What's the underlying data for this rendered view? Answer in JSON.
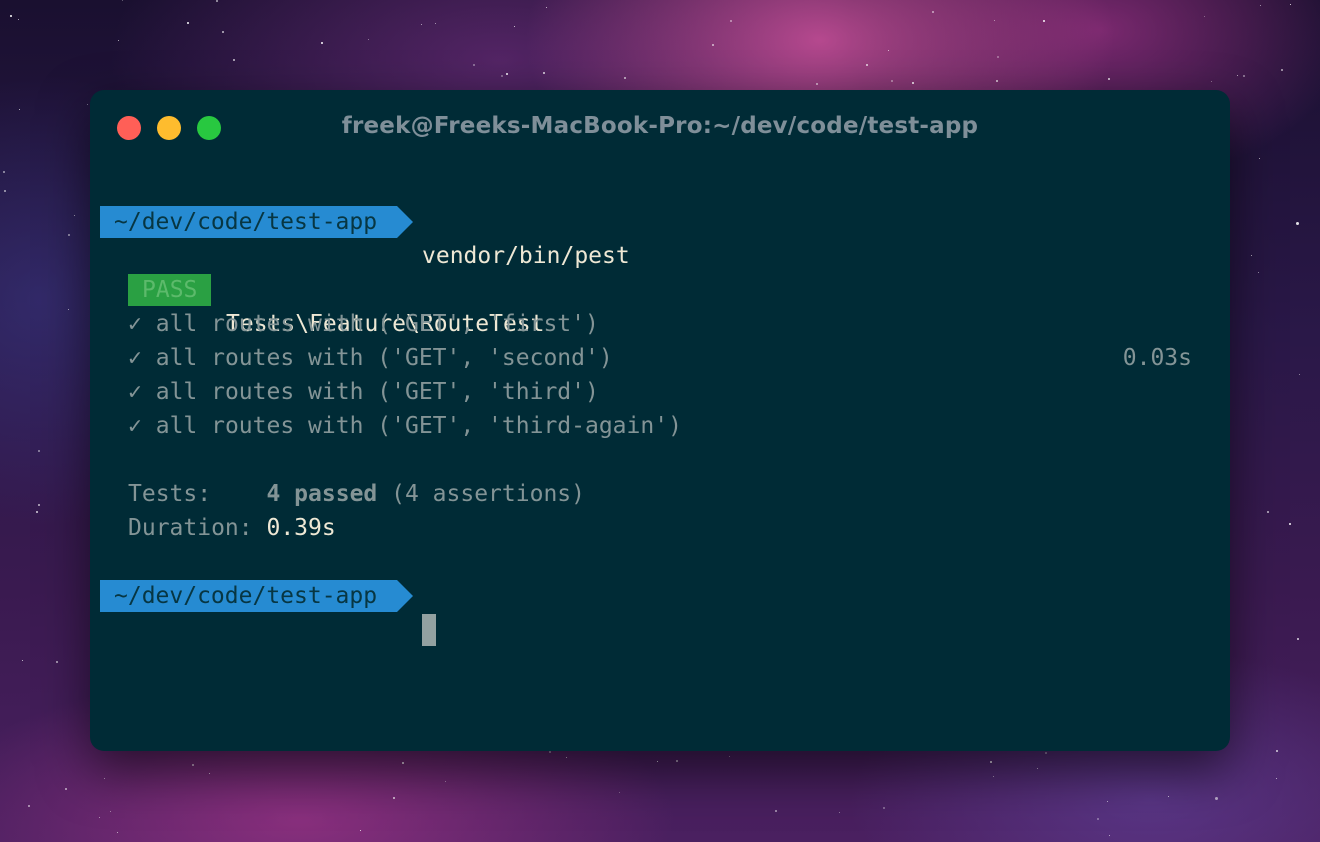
{
  "window": {
    "title": "freek@Freeks-MacBook-Pro:~/dev/code/test-app"
  },
  "terminal": {
    "prompt_path": "~/dev/code/test-app",
    "command": "vendor/bin/pest",
    "result_badge": "PASS",
    "suite_name": "Tests\\Feature\\RouteTest",
    "check_mark": "✓",
    "tests": [
      {
        "label": "all routes with ('GET', 'first')",
        "time": "0.03s"
      },
      {
        "label": "all routes with ('GET', 'second')",
        "time": ""
      },
      {
        "label": "all routes with ('GET', 'third')",
        "time": ""
      },
      {
        "label": "all routes with ('GET', 'third-again')",
        "time": ""
      }
    ],
    "summary": {
      "tests_label": "Tests:",
      "tests_passed": "4 passed",
      "tests_assertions": "(4 assertions)",
      "duration_label": "Duration:",
      "duration_value": "0.39s"
    }
  },
  "colors": {
    "terminal_bg": "#002b36",
    "prompt_bg": "#268bd2",
    "pass_bg": "#2aa043",
    "traffic_red": "#ff5f57",
    "traffic_yellow": "#febc2e",
    "traffic_green": "#28c840"
  }
}
